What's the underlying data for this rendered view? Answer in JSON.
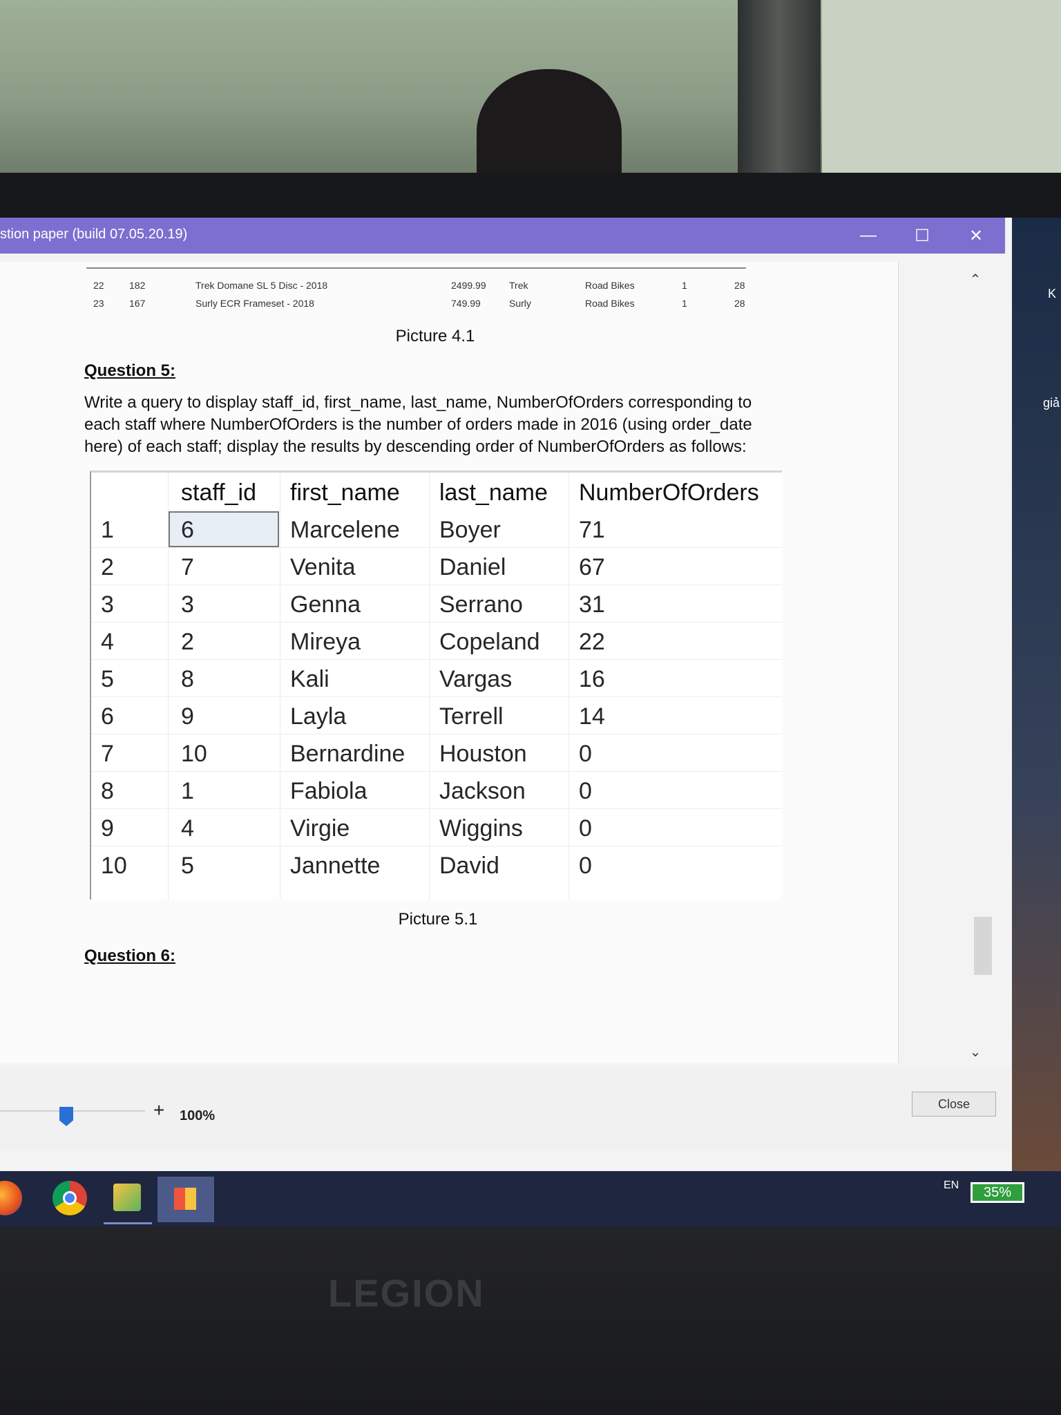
{
  "window": {
    "title": "stion paper (build 07.05.20.19)",
    "minimize_glyph": "—",
    "maximize_glyph": "☐",
    "close_glyph": "✕"
  },
  "previous_table": {
    "rows": [
      {
        "n": "22",
        "id": "182",
        "name": "Trek Domane SL 5 Disc - 2018",
        "price": "2499.99",
        "brand": "Trek",
        "category": "Road Bikes",
        "qty": "1",
        "num": "28"
      },
      {
        "n": "23",
        "id": "167",
        "name": "Surly ECR Frameset - 2018",
        "price": "749.99",
        "brand": "Surly",
        "category": "Road Bikes",
        "qty": "1",
        "num": "28"
      }
    ]
  },
  "picture_4_1": "Picture 4.1",
  "question5": {
    "heading": "Question 5:",
    "text": "Write a query to display staff_id, first_name, last_name, NumberOfOrders corresponding to each staff where NumberOfOrders is the number of orders made in 2016 (using order_date here) of each staff; display the results by descending order of NumberOfOrders as follows:"
  },
  "result_table": {
    "columns": [
      "staff_id",
      "first_name",
      "last_name",
      "NumberOfOrders"
    ],
    "rows": [
      {
        "n": "1",
        "staff_id": "6",
        "first_name": "Marcelene",
        "last_name": "Boyer",
        "orders": "71"
      },
      {
        "n": "2",
        "staff_id": "7",
        "first_name": "Venita",
        "last_name": "Daniel",
        "orders": "67"
      },
      {
        "n": "3",
        "staff_id": "3",
        "first_name": "Genna",
        "last_name": "Serrano",
        "orders": "31"
      },
      {
        "n": "4",
        "staff_id": "2",
        "first_name": "Mireya",
        "last_name": "Copeland",
        "orders": "22"
      },
      {
        "n": "5",
        "staff_id": "8",
        "first_name": "Kali",
        "last_name": "Vargas",
        "orders": "16"
      },
      {
        "n": "6",
        "staff_id": "9",
        "first_name": "Layla",
        "last_name": "Terrell",
        "orders": "14"
      },
      {
        "n": "7",
        "staff_id": "10",
        "first_name": "Bernardine",
        "last_name": "Houston",
        "orders": "0"
      },
      {
        "n": "8",
        "staff_id": "1",
        "first_name": "Fabiola",
        "last_name": "Jackson",
        "orders": "0"
      },
      {
        "n": "9",
        "staff_id": "4",
        "first_name": "Virgie",
        "last_name": "Wiggins",
        "orders": "0"
      },
      {
        "n": "10",
        "staff_id": "5",
        "first_name": "Jannette",
        "last_name": "David",
        "orders": "0"
      }
    ]
  },
  "picture_5_1": "Picture 5.1",
  "question6": {
    "heading": "Question 6:"
  },
  "zoom": {
    "plus": "+",
    "value": "100%"
  },
  "close_label": "Close",
  "taskbar": {
    "lang": "EN",
    "battery": "35%"
  },
  "desktop": {
    "label_1": "K",
    "label_2": "giả"
  },
  "laptop_brand": "LEGION",
  "colors": {
    "titlebar": "#7d6fd0",
    "taskbar": "#1e2640",
    "battery": "#2f9e3d"
  }
}
